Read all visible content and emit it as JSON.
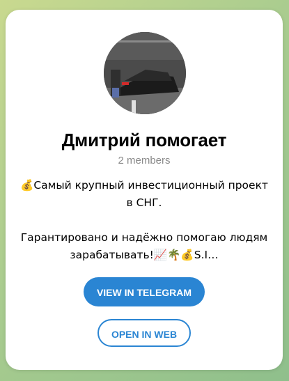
{
  "channel": {
    "title": "Дмитрий помогает",
    "members": "2 members",
    "description_line1": "💰Самый крупный инвестиционный проект в СНГ.",
    "description_line2": "Гарантировано и надёжно помогаю людям зарабатывать!📈🌴💰S.I…"
  },
  "buttons": {
    "view_in_telegram": "VIEW IN TELEGRAM",
    "open_in_web": "OPEN IN WEB"
  },
  "colors": {
    "accent": "#2a85d3",
    "background_gradient_start": "#c9d98f",
    "background_gradient_end": "#8fbf8c",
    "card": "#ffffff",
    "muted_text": "#8a8a8a"
  }
}
